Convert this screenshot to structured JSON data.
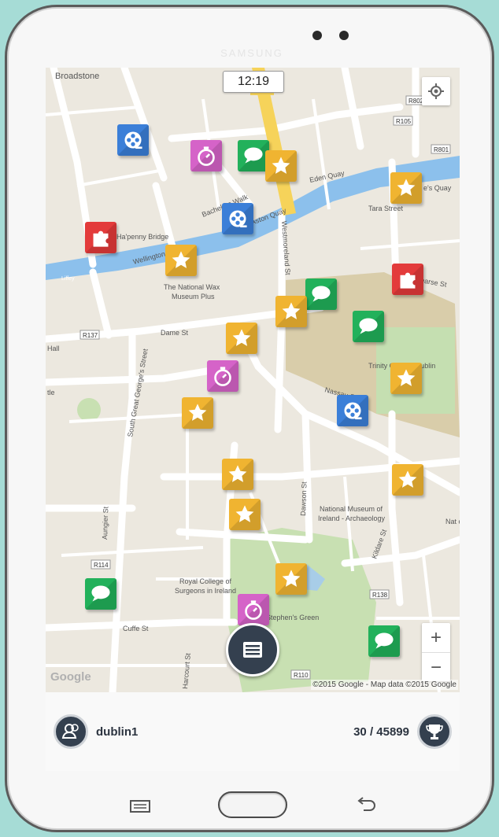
{
  "device": {
    "brand": "SAMSUNG"
  },
  "status": {
    "time": "12:19"
  },
  "map": {
    "labels": [
      {
        "text": "Broadstone",
        "key": "l0"
      },
      {
        "text": "Eden Quay",
        "key": "l1"
      },
      {
        "text": "Tara Street",
        "key": "l2"
      },
      {
        "text": "Ha'penny Bridge",
        "key": "l3"
      },
      {
        "text": "The National Wax",
        "key": "l4"
      },
      {
        "text": "Museum Plus",
        "key": "l5"
      },
      {
        "text": "Dame St",
        "key": "l6"
      },
      {
        "text": "Trinity College Dublin",
        "key": "l7"
      },
      {
        "text": "National Museum of",
        "key": "l8"
      },
      {
        "text": "Ireland - Archaeology",
        "key": "l9"
      },
      {
        "text": "Royal College of",
        "key": "l10"
      },
      {
        "text": "Surgeons in Ireland",
        "key": "l11"
      },
      {
        "text": "Stephen's Green",
        "key": "l12"
      },
      {
        "text": "Cuffe St",
        "key": "l13"
      },
      {
        "text": "South Great George's Street",
        "key": "l14"
      },
      {
        "text": "Westmoreland St",
        "key": "l15"
      },
      {
        "text": "Pearse St",
        "key": "l16"
      },
      {
        "text": "Dawson St",
        "key": "l17"
      },
      {
        "text": "Kildare St",
        "key": "l18"
      },
      {
        "text": "Harcourt St",
        "key": "l19"
      },
      {
        "text": "Bachelors Walk",
        "key": "l20"
      },
      {
        "text": "Aston Quay",
        "key": "l21"
      },
      {
        "text": "Wellington Quay",
        "key": "l22"
      },
      {
        "text": "Nassau St",
        "key": "l23"
      },
      {
        "text": "Aungier St",
        "key": "l24"
      },
      {
        "text": "R802",
        "key": "l25"
      },
      {
        "text": "R105",
        "key": "l26"
      },
      {
        "text": "R801",
        "key": "l27"
      },
      {
        "text": "R137",
        "key": "l28"
      },
      {
        "text": "R114",
        "key": "l29"
      },
      {
        "text": "R138",
        "key": "l30"
      },
      {
        "text": "R110",
        "key": "l31"
      },
      {
        "text": "Hall",
        "key": "l32"
      },
      {
        "text": "Liffey",
        "key": "l33"
      },
      {
        "text": "Nat of Ir",
        "key": "l34"
      },
      {
        "text": "tle",
        "key": "l35"
      },
      {
        "text": "e's Quay",
        "key": "l36"
      }
    ],
    "markers": [
      {
        "type": "film",
        "key": "m0"
      },
      {
        "type": "timer",
        "key": "m1"
      },
      {
        "type": "chat",
        "key": "m2"
      },
      {
        "type": "star",
        "key": "m3"
      },
      {
        "type": "star",
        "key": "m4"
      },
      {
        "type": "film",
        "key": "m5"
      },
      {
        "type": "puzzle",
        "key": "m6"
      },
      {
        "type": "star",
        "key": "m7"
      },
      {
        "type": "puzzle",
        "key": "m8"
      },
      {
        "type": "chat",
        "key": "m9"
      },
      {
        "type": "star",
        "key": "m10"
      },
      {
        "type": "chat",
        "key": "m11"
      },
      {
        "type": "star",
        "key": "m12"
      },
      {
        "type": "timer",
        "key": "m13"
      },
      {
        "type": "star",
        "key": "m14"
      },
      {
        "type": "star",
        "key": "m15"
      },
      {
        "type": "film",
        "key": "m16"
      },
      {
        "type": "star",
        "key": "m17"
      },
      {
        "type": "star",
        "key": "m18"
      },
      {
        "type": "star",
        "key": "m19"
      },
      {
        "type": "star",
        "key": "m20"
      },
      {
        "type": "chat",
        "key": "m21"
      },
      {
        "type": "timer",
        "key": "m22"
      },
      {
        "type": "chat",
        "key": "m23"
      }
    ],
    "zoom_in_label": "+",
    "zoom_out_label": "−",
    "google_logo": "Google",
    "attribution": "©2015 Google - Map data ©2015 Google"
  },
  "player": {
    "username": "dublin1",
    "score": "30 / 45899"
  },
  "colors": {
    "film": "#3b7fd8",
    "timer": "#d563c8",
    "chat": "#22b15b",
    "star": "#f0b431",
    "puzzle": "#e33b3b",
    "dark": "#34404f"
  }
}
